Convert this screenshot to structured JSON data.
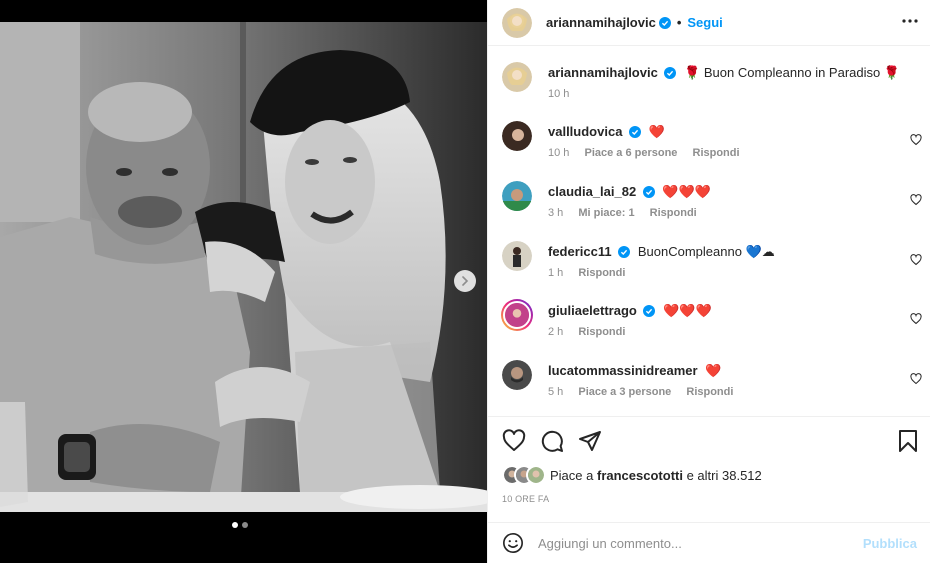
{
  "post": {
    "author": "ariannamihajlovic",
    "follow_label": "Segui",
    "separator": "•",
    "carousel": {
      "total_slides": 2,
      "active_slide": 1
    }
  },
  "caption": {
    "username": "ariannamihajlovic",
    "text_before": "🌹",
    "text": "Buon Compleanno in Paradiso",
    "text_after": "🌹",
    "time": "10 h"
  },
  "comments": [
    {
      "username": "vallludovica",
      "verified": true,
      "text": "❤️",
      "time": "10 h",
      "likes": "Piace a 6 persone",
      "reply": "Rispondi"
    },
    {
      "username": "claudia_lai_82",
      "verified": true,
      "text": "❤️❤️❤️",
      "time": "3 h",
      "likes": "Mi piace: 1",
      "reply": "Rispondi"
    },
    {
      "username": "federicc11",
      "verified": true,
      "text": "BuonCompleanno 💙☁",
      "time": "1 h",
      "likes": "",
      "reply": "Rispondi"
    },
    {
      "username": "giuliaelettrago",
      "verified": true,
      "text": "❤️❤️❤️",
      "time": "2 h",
      "likes": "",
      "reply": "Rispondi"
    },
    {
      "username": "lucatommassinidreamer",
      "verified": false,
      "text": "❤️",
      "time": "5 h",
      "likes": "Piace a 3 persone",
      "reply": "Rispondi"
    }
  ],
  "likes": {
    "prefix": "Piace a",
    "user": "francescototti",
    "suffix": "e altri 38.512"
  },
  "posted_ago": "10 ORE FA",
  "add_comment": {
    "placeholder": "Aggiungi un commento...",
    "publish_label": "Pubblica"
  },
  "colors": {
    "accent": "#0095f6",
    "publish_disabled": "#b2dffc",
    "secondary_text": "#8e8e8e",
    "border": "#efefef"
  },
  "icons": [
    "more-options-icon",
    "verified-badge-icon",
    "like-heart-icon",
    "comment-icon",
    "share-icon",
    "bookmark-icon",
    "emoji-icon",
    "carousel-next-icon"
  ]
}
